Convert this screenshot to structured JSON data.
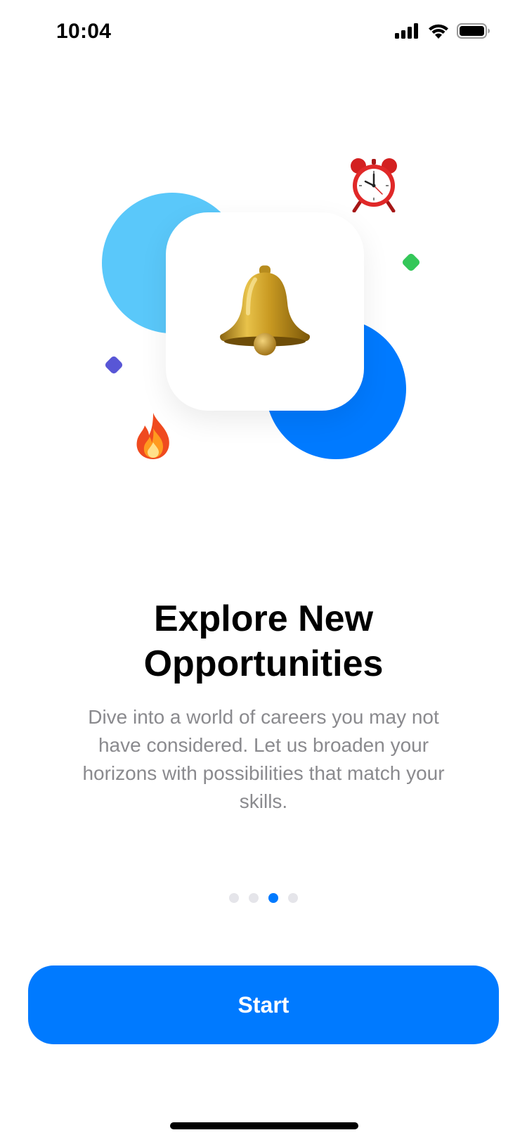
{
  "status_bar": {
    "time": "10:04"
  },
  "illustration": {
    "center_icon": "bell-icon",
    "decorations": [
      "alarm-clock-icon",
      "fire-icon",
      "green-diamond",
      "purple-diamond"
    ]
  },
  "onboarding": {
    "title": "Explore New Opportunities",
    "description": "Dive into a world of careers you may not have considered. Let us broaden your horizons with possibilities that match your skills."
  },
  "pagination": {
    "total": 4,
    "current": 3
  },
  "start_button": {
    "label": "Start"
  },
  "colors": {
    "accent": "#007aff",
    "accent_light": "#5ac8fa",
    "green": "#34c759",
    "purple": "#5856d6",
    "inactive_dot": "#e5e5ea",
    "secondary_text": "#8a8a8e"
  }
}
